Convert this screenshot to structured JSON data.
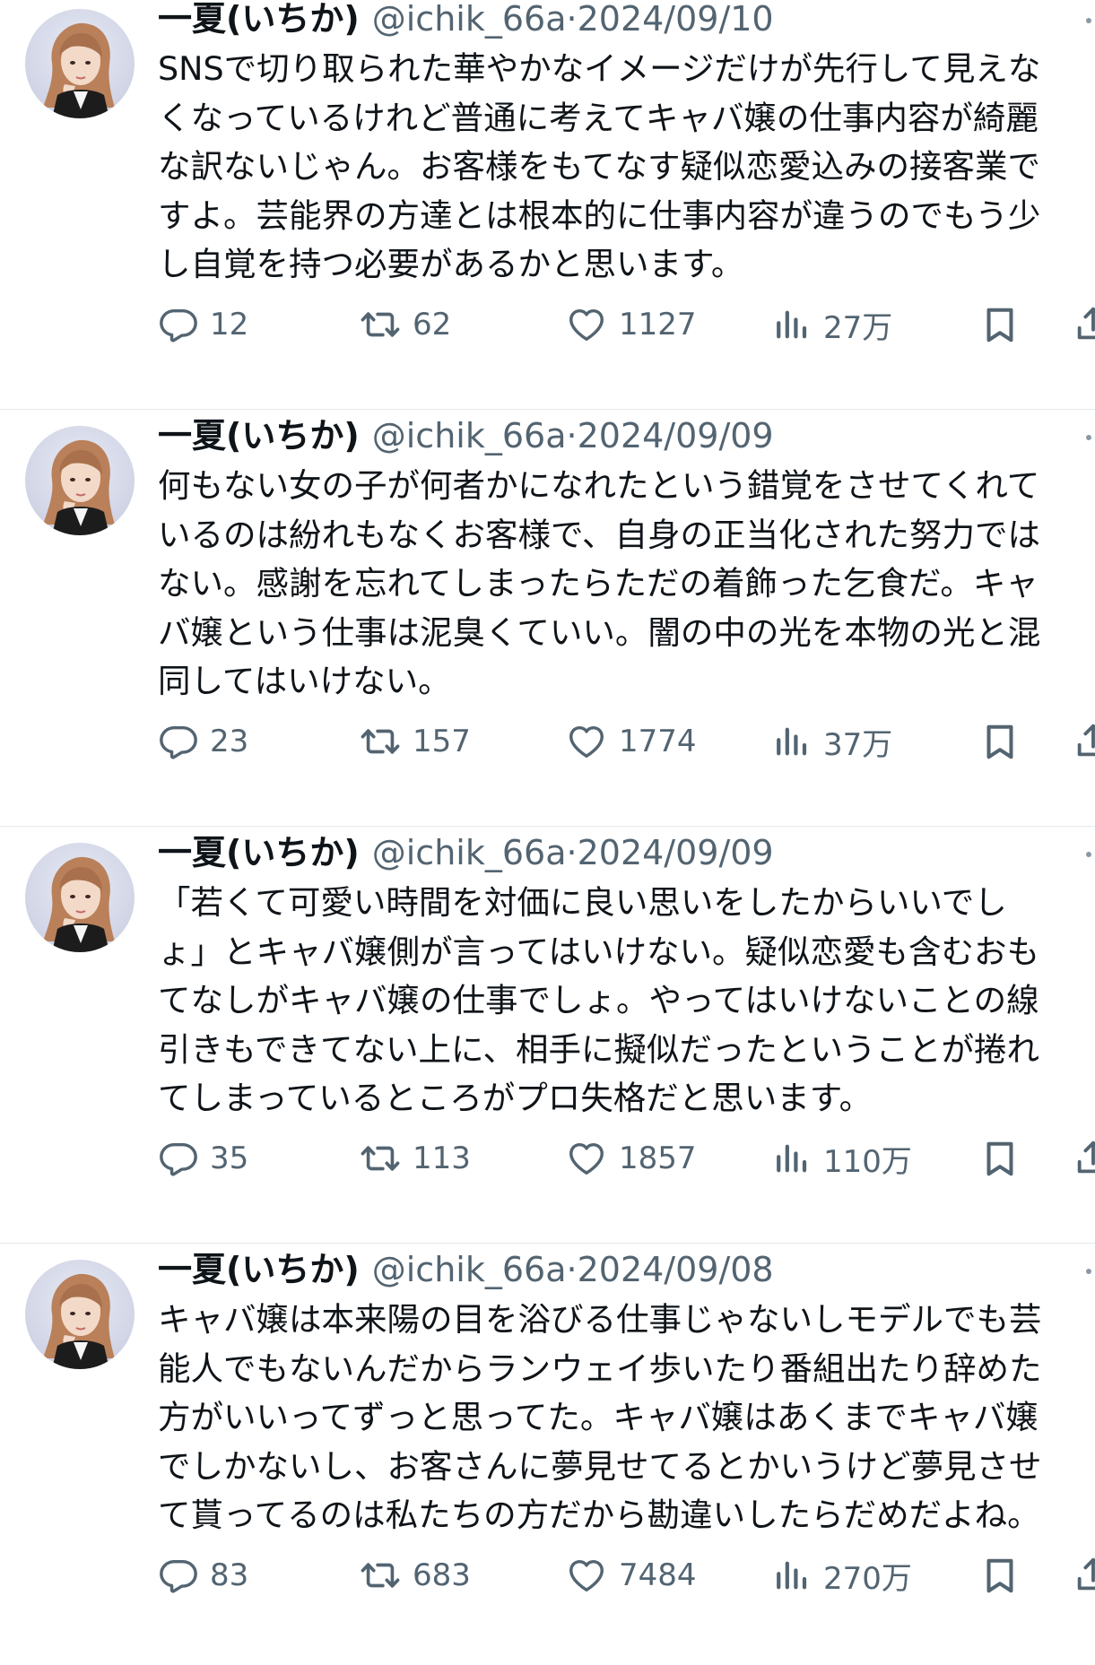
{
  "tweets": [
    {
      "name": "一夏(いちか)",
      "handle": "@ichik_66a",
      "sep": "·",
      "date": "2024/09/10",
      "lines": [
        "SNSで切り取られた華やかなイメージだけが先行して見えな",
        "くなっているけれど普通に考えてキャバ嬢の仕事内容が綺麗",
        "な訳ないじゃん。お客様をもてなす疑似恋愛込みの接客業で",
        "すよ。芸能界の方達とは根本的に仕事内容が違うのでもう少",
        "し自覚を持つ必要があるかと思います。"
      ],
      "replies": "12",
      "reposts": "62",
      "likes": "1127",
      "views": "27万"
    },
    {
      "name": "一夏(いちか)",
      "handle": "@ichik_66a",
      "sep": "·",
      "date": "2024/09/09",
      "lines": [
        "何もない女の子が何者かになれたという錯覚をさせてくれて",
        "いるのは紛れもなくお客様で、自身の正当化された努力では",
        "ない。感謝を忘れてしまったらただの着飾った乞食だ。キャ",
        "バ嬢という仕事は泥臭くていい。闇の中の光を本物の光と混",
        "同してはいけない。"
      ],
      "replies": "23",
      "reposts": "157",
      "likes": "1774",
      "views": "37万"
    },
    {
      "name": "一夏(いちか)",
      "handle": "@ichik_66a",
      "sep": "·",
      "date": "2024/09/09",
      "lines": [
        "「若くて可愛い時間を対価に良い思いをしたからいいでし",
        "ょ」とキャバ嬢側が言ってはいけない。疑似恋愛も含むおも",
        "てなしがキャバ嬢の仕事でしょ。やってはいけないことの線",
        "引きもできてない上に、相手に擬似だったということが捲れ",
        "てしまっているところがプロ失格だと思います。"
      ],
      "replies": "35",
      "reposts": "113",
      "likes": "1857",
      "views": "110万"
    },
    {
      "name": "一夏(いちか)",
      "handle": "@ichik_66a",
      "sep": "·",
      "date": "2024/09/08",
      "lines": [
        "キャバ嬢は本来陽の目を浴びる仕事じゃないしモデルでも芸",
        "能人でもないんだからランウェイ歩いたり番組出たり辞めた",
        "方がいいってずっと思ってた。キャバ嬢はあくまでキャバ嬢",
        "でしかないし、お客さんに夢見せてるとかいうけど夢見させ",
        "て貰ってるのは私たちの方だから勘違いしたらだめだよね。"
      ],
      "replies": "83",
      "reposts": "683",
      "likes": "7484",
      "views": "270万"
    }
  ],
  "icons": {
    "reply": "reply-icon",
    "repost": "repost-icon",
    "like": "like-icon",
    "views": "views-icon",
    "bookmark": "bookmark-icon",
    "share": "share-icon"
  },
  "colors": {
    "text": "#0f1419",
    "secondary": "#536471",
    "divider": "#e6e8eb"
  }
}
